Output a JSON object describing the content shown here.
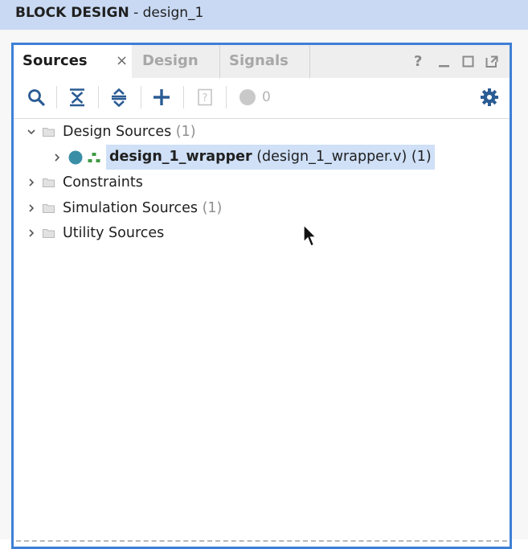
{
  "window": {
    "title_bold": "BLOCK DESIGN",
    "title_rest": " - design_1"
  },
  "tabs": [
    {
      "label": "Sources",
      "active": true
    },
    {
      "label": "Design",
      "active": false
    },
    {
      "label": "Signals",
      "active": false
    }
  ],
  "tab_close": "×",
  "window_controls": {
    "help": "?"
  },
  "toolbar": {
    "icons": [
      "search-icon",
      "collapse-all-icon",
      "expand-all-icon",
      "add-icon",
      "properties-icon",
      "status-dot-icon",
      "settings-gear-icon"
    ],
    "error_count": "0"
  },
  "tree": {
    "design_sources": {
      "label": "Design Sources",
      "count": "(1)"
    },
    "wrapper": {
      "name": "design_1_wrapper",
      "file": "(design_1_wrapper.v)",
      "count": "(1)"
    },
    "constraints": {
      "label": "Constraints"
    },
    "simulation_sources": {
      "label": "Simulation Sources",
      "count": "(1)"
    },
    "utility_sources": {
      "label": "Utility Sources"
    }
  },
  "colors": {
    "title_bar": "#c9d9f3",
    "panel_border": "#3e7fd6",
    "selection": "#cfe0f7",
    "icon_blue": "#2b5c94",
    "module_dot": "#3a8fa6"
  }
}
